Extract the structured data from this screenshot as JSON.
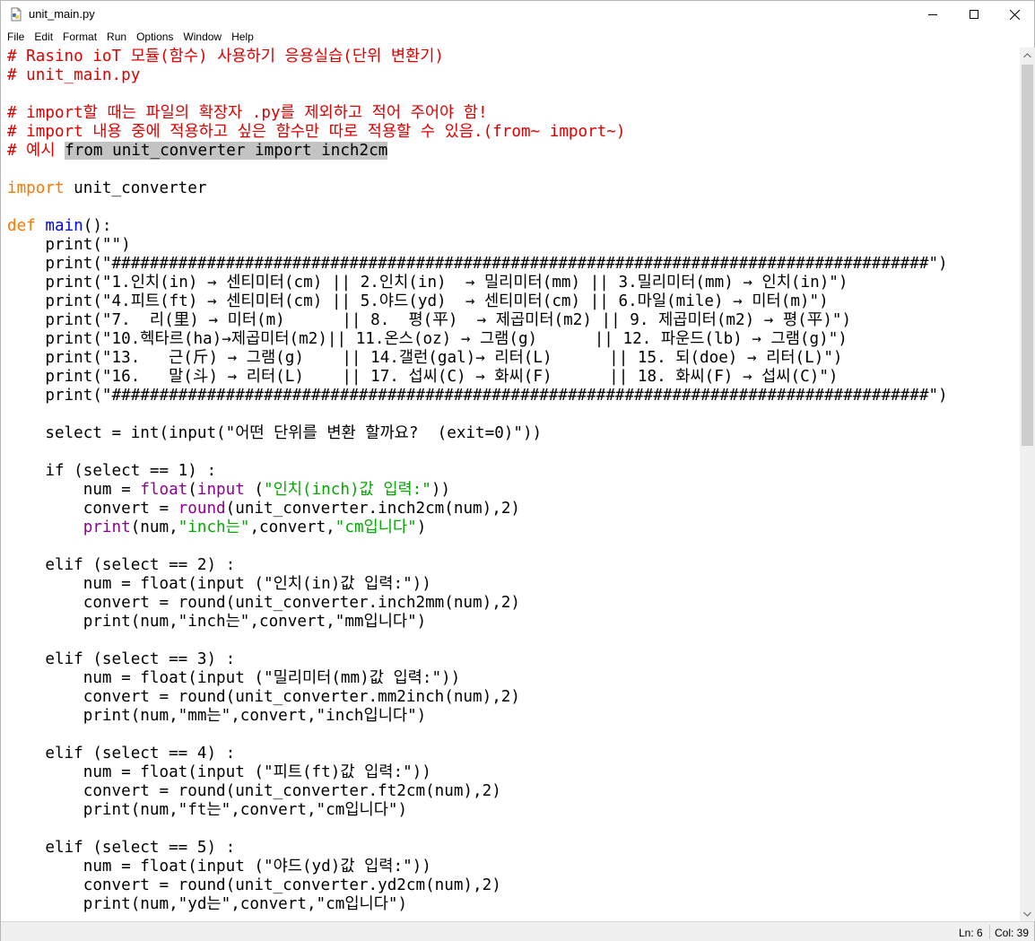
{
  "window": {
    "title": "unit_main.py",
    "icon": "python-file-icon"
  },
  "menu": [
    "File",
    "Edit",
    "Format",
    "Run",
    "Options",
    "Window",
    "Help"
  ],
  "status": {
    "ln": "Ln: 6",
    "col": "Col: 39"
  },
  "colors": {
    "comment": "#dd0000",
    "keyword": "#ff7700",
    "string": "#00aa00",
    "builtin": "#900090",
    "definition": "#0000ff",
    "selection": "#c3c3c3"
  },
  "code_lines": [
    [
      {
        "c": "cmt",
        "t": "# Rasino ioT 모듈(함수) 사용하기 응용실습(단위 변환기)"
      }
    ],
    [
      {
        "c": "cmt",
        "t": "# unit_main.py"
      }
    ],
    [
      {
        "c": "",
        "t": ""
      }
    ],
    [
      {
        "c": "cmt",
        "t": "# import할 때는 파일의 확장자 .py를 제외하고 적어 주어야 함!"
      }
    ],
    [
      {
        "c": "cmt",
        "t": "# import 내용 중에 적용하고 싶은 함수만 따로 적용할 수 있음.(from~ import~)"
      }
    ],
    [
      {
        "c": "cmt",
        "t": "# 예시 "
      },
      {
        "c": "sel",
        "t": "from unit_converter import inch2cm"
      }
    ],
    [
      {
        "c": "",
        "t": ""
      }
    ],
    [
      {
        "c": "kw",
        "t": "import"
      },
      {
        "c": "",
        "t": " unit_converter"
      }
    ],
    [
      {
        "c": "",
        "t": ""
      }
    ],
    [
      {
        "c": "kw",
        "t": "def"
      },
      {
        "c": "",
        "t": " "
      },
      {
        "c": "def",
        "t": "main"
      },
      {
        "c": "",
        "t": "():"
      }
    ],
    [
      {
        "c": "",
        "t": "    print(\"\")"
      }
    ],
    [
      {
        "c": "",
        "t": "    print(\"######################################################################################\")"
      }
    ],
    [
      {
        "c": "",
        "t": "    print(\"1.인치(in) → 센티미터(cm) || 2.인치(in)  → 밀리미터(mm) || 3.밀리미터(mm) → 인치(in)\")"
      }
    ],
    [
      {
        "c": "",
        "t": "    print(\"4.피트(ft) → 센티미터(cm) || 5.야드(yd)  → 센티미터(cm) || 6.마일(mile) → 미터(m)\")"
      }
    ],
    [
      {
        "c": "",
        "t": "    print(\"7.  리(里) → 미터(m)      || 8.  평(平)  → 제곱미터(m2) || 9. 제곱미터(m2) → 평(平)\")"
      }
    ],
    [
      {
        "c": "",
        "t": "    print(\"10.헥타르(ha)→제곱미터(m2)|| 11.온스(oz) → 그램(g)      || 12. 파운드(lb) → 그램(g)\")"
      }
    ],
    [
      {
        "c": "",
        "t": "    print(\"13.   근(斤) → 그램(g)    || 14.갤런(gal)→ 리터(L)      || 15. 되(doe) → 리터(L)\")"
      }
    ],
    [
      {
        "c": "",
        "t": "    print(\"16.   말(斗) → 리터(L)    || 17. 섭씨(C) → 화씨(F)      || 18. 화씨(F) → 섭씨(C)\")"
      }
    ],
    [
      {
        "c": "",
        "t": "    print(\"######################################################################################\")"
      }
    ],
    [
      {
        "c": "",
        "t": ""
      }
    ],
    [
      {
        "c": "",
        "t": "    select = int(input(\"어떤 단위를 변환 할까요?  (exit=0)\"))"
      }
    ],
    [
      {
        "c": "",
        "t": ""
      }
    ],
    [
      {
        "c": "",
        "t": "    if (select == 1) :"
      }
    ],
    [
      {
        "c": "",
        "t": "        num = "
      },
      {
        "c": "bi",
        "t": "float"
      },
      {
        "c": "",
        "t": "("
      },
      {
        "c": "bi",
        "t": "input"
      },
      {
        "c": "",
        "t": " ("
      },
      {
        "c": "str",
        "t": "\"인치(inch)값 입력:\""
      },
      {
        "c": "",
        "t": "))"
      }
    ],
    [
      {
        "c": "",
        "t": "        convert = "
      },
      {
        "c": "bi",
        "t": "round"
      },
      {
        "c": "",
        "t": "(unit_converter.inch2cm(num),2)"
      }
    ],
    [
      {
        "c": "",
        "t": "        "
      },
      {
        "c": "bi",
        "t": "print"
      },
      {
        "c": "",
        "t": "(num,"
      },
      {
        "c": "str",
        "t": "\"inch는\""
      },
      {
        "c": "",
        "t": ",convert,"
      },
      {
        "c": "str",
        "t": "\"cm입니다\""
      },
      {
        "c": "",
        "t": ")"
      }
    ],
    [
      {
        "c": "",
        "t": ""
      }
    ],
    [
      {
        "c": "",
        "t": "    elif (select == 2) :"
      }
    ],
    [
      {
        "c": "",
        "t": "        num = float(input (\"인치(in)값 입력:\"))"
      }
    ],
    [
      {
        "c": "",
        "t": "        convert = round(unit_converter.inch2mm(num),2)"
      }
    ],
    [
      {
        "c": "",
        "t": "        print(num,\"inch는\",convert,\"mm입니다\")"
      }
    ],
    [
      {
        "c": "",
        "t": ""
      }
    ],
    [
      {
        "c": "",
        "t": "    elif (select == 3) :"
      }
    ],
    [
      {
        "c": "",
        "t": "        num = float(input (\"밀리미터(mm)값 입력:\"))"
      }
    ],
    [
      {
        "c": "",
        "t": "        convert = round(unit_converter.mm2inch(num),2)"
      }
    ],
    [
      {
        "c": "",
        "t": "        print(num,\"mm는\",convert,\"inch입니다\")"
      }
    ],
    [
      {
        "c": "",
        "t": ""
      }
    ],
    [
      {
        "c": "",
        "t": "    elif (select == 4) :"
      }
    ],
    [
      {
        "c": "",
        "t": "        num = float(input (\"피트(ft)값 입력:\"))"
      }
    ],
    [
      {
        "c": "",
        "t": "        convert = round(unit_converter.ft2cm(num),2)"
      }
    ],
    [
      {
        "c": "",
        "t": "        print(num,\"ft는\",convert,\"cm입니다\")"
      }
    ],
    [
      {
        "c": "",
        "t": ""
      }
    ],
    [
      {
        "c": "",
        "t": "    elif (select == 5) :"
      }
    ],
    [
      {
        "c": "",
        "t": "        num = float(input (\"야드(yd)값 입력:\"))"
      }
    ],
    [
      {
        "c": "",
        "t": "        convert = round(unit_converter.yd2cm(num),2)"
      }
    ],
    [
      {
        "c": "",
        "t": "        print(num,\"yd는\",convert,\"cm입니다\")"
      }
    ]
  ]
}
